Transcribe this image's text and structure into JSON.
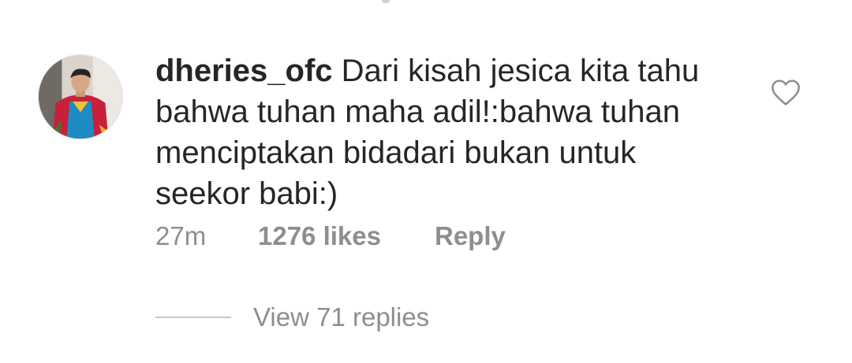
{
  "comment": {
    "username": "dheries_ofc",
    "text": "Dari kisah jesica kita tahu bahwa tuhan maha adil!:bahwa tuhan menciptakan bidadari bukan untuk seekor babi:)",
    "time": "27m",
    "likes": "1276 likes",
    "reply_label": "Reply",
    "view_replies": "View 71 replies"
  },
  "icons": {
    "like": "heart-outline-icon",
    "avatar": "profile-photo"
  },
  "colors": {
    "text": "#262626",
    "secondary": "#8e8e8e",
    "divider": "#c7c7c7"
  }
}
